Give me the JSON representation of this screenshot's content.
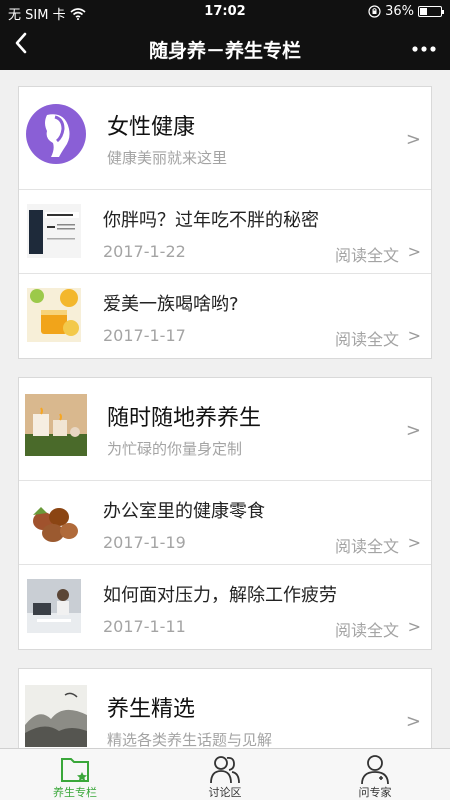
{
  "status_bar": {
    "carrier": "无 SIM 卡",
    "time": "17:02",
    "battery_percent": "36%",
    "battery_level": 0.36
  },
  "nav": {
    "title": "随身养－养生专栏",
    "back_icon": "back-chevron-icon",
    "more_icon": "more-dots-icon"
  },
  "sections": [
    {
      "title": "女性健康",
      "subtitle": "健康美丽就来这里",
      "chevron": ">",
      "articles": [
        {
          "title": "你胖吗？过年吃不胖的秘密",
          "date": "2017-1-22",
          "read": "阅读全文",
          "chevron": ">"
        },
        {
          "title": "爱美一族喝啥哟?",
          "date": "2017-1-17",
          "read": "阅读全文",
          "chevron": ">"
        }
      ]
    },
    {
      "title": "随时随地养养生",
      "subtitle": "为忙碌的你量身定制",
      "chevron": ">",
      "articles": [
        {
          "title": "办公室里的健康零食",
          "date": "2017-1-19",
          "read": "阅读全文",
          "chevron": ">"
        },
        {
          "title": "如何面对压力，解除工作疲劳",
          "date": "2017-1-11",
          "read": "阅读全文",
          "chevron": ">"
        }
      ]
    },
    {
      "title": "养生精选",
      "subtitle": "精选各类养生话题与见解",
      "chevron": ">",
      "articles": []
    }
  ],
  "tabs": [
    {
      "label": "养生专栏",
      "icon": "folder-star-icon",
      "active": true
    },
    {
      "label": "讨论区",
      "icon": "users-icon",
      "active": false
    },
    {
      "label": "问专家",
      "icon": "doctor-icon",
      "active": false
    }
  ],
  "colors": {
    "bar_bg": "#111111",
    "accent_green": "#3aa73a",
    "female_purple": "#8a5fd6",
    "muted_text": "#a4a4a4"
  }
}
